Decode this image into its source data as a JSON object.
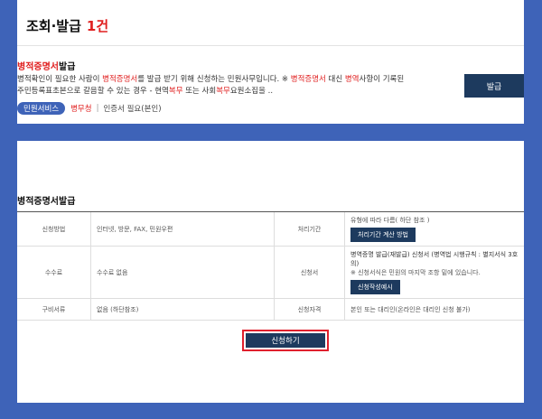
{
  "header": {
    "title": "조회·발급",
    "count": "1건"
  },
  "service": {
    "title_red": "병적증명서",
    "title_rest": "발급",
    "desc_line1_parts": [
      "병적확인이 필요한 사람이 ",
      "병적증명서",
      "를 발급 받기 위해 신청하는 민원사무입니다. ※ ",
      "병적증명서",
      " 대신 ",
      "병역",
      "사항이 기록된"
    ],
    "desc_line2_parts": [
      "주민등록표초본으로 갈음할 수 있는 경우 - 현역",
      "복무",
      " 또는 사회",
      "복무",
      "요원소집을 .."
    ],
    "tag": "민원서비스",
    "dept": "병무청",
    "note": "인증서 필요(본인)",
    "issue_button": "발급"
  },
  "detail": {
    "title": "병적증명서발급",
    "rows": [
      {
        "h1": "신청방법",
        "v1": "인터넷, 방문, FAX, 민원우편",
        "h2": "처리기간",
        "v2": "유형에 따라 다름( 하단 참조 )",
        "btn": "처리기간 계산 방법"
      },
      {
        "h1": "수수료",
        "v1": "수수료 없음",
        "h2": "신청서",
        "v2a": "병역증명 발급(재발급) 신청서 (병역법 시행규칙 : 별지서식 3호의)",
        "v2b": "※ 신청서식은 민원의 마지막 조항 밑에 있습니다.",
        "btn": "신청작성예시"
      },
      {
        "h1": "구비서류",
        "v1": "없음 (하단참조)",
        "h2": "신청자격",
        "v2": "본인 또는 대리인(온라인은 대리인 신청 불가)"
      }
    ],
    "apply_button": "신청하기"
  }
}
